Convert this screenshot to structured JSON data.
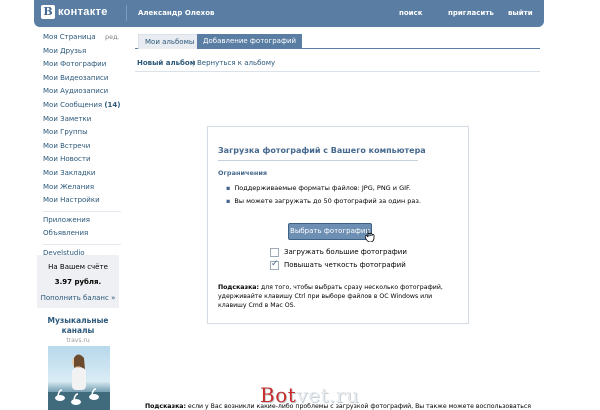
{
  "header": {
    "logo_letter": "В",
    "logo_text": "контакте",
    "user_name": "Александр Олехов",
    "links": [
      "поиск",
      "пригласить",
      "выйти"
    ],
    "accent_color": "#597da3"
  },
  "sidebar": {
    "edit_label": "ред.",
    "items": [
      {
        "label": "Моя Страница"
      },
      {
        "label": "Мои Друзья"
      },
      {
        "label": "Мои Фотографии"
      },
      {
        "label": "Мои Видеозаписи"
      },
      {
        "label": "Мои Аудиозаписи"
      },
      {
        "label": "Мои Сообщения",
        "count": "(14)"
      },
      {
        "label": "Мои Заметки"
      },
      {
        "label": "Мои Группы"
      },
      {
        "label": "Мои Встречи"
      },
      {
        "label": "Мои Новости"
      },
      {
        "label": "Мои Закладки"
      },
      {
        "label": "Мои Желания"
      },
      {
        "label": "Мои Настройки"
      }
    ],
    "extra_items": [
      "Приложения",
      "Объявления"
    ],
    "dev_item": "Develstudio",
    "balance": {
      "line1": "На Вашем счёте",
      "amount": "3.97 рубля.",
      "link": "Пополнить баланс »"
    },
    "ad": {
      "title": "Музыкальные каналы",
      "site": "travs.ru"
    }
  },
  "tabs": [
    {
      "label": "Мои альбомы",
      "active": false
    },
    {
      "label": "Добавление фотографий",
      "active": true
    }
  ],
  "subnav": {
    "new_album": "Новый альбом",
    "separator": "|",
    "back": "Вернуться к альбому"
  },
  "upload": {
    "title": "Загрузка фотографий с Вашего компьютера",
    "limits_title": "Ограничения",
    "bullets": [
      "Поддерживаемые форматы файлов: JPG, PNG и GIF.",
      "Вы можете загружать до 50 фотографий за один раз."
    ],
    "button": "Выбрать фотографии",
    "options": [
      {
        "label": "Загружать большие фотографии",
        "checked": false
      },
      {
        "label": "Повышать четкость фотографий",
        "checked": true
      }
    ],
    "hint_bold": "Подсказка:",
    "hint_text": " для того, чтобы выбрать сразу несколько фотографий, удерживайте клавишу Ctrl при выборе файлов в ОС Windows или клавишу Cmd в Mac OS."
  },
  "bottom_hint": {
    "bold": "Подсказка:",
    "text": " если у Вас возникли какие-либо проблемы с загрузкой фотографий, Вы также можете воспользоваться"
  },
  "watermark": {
    "part1": "Bot",
    "part2": "vet.ru"
  }
}
